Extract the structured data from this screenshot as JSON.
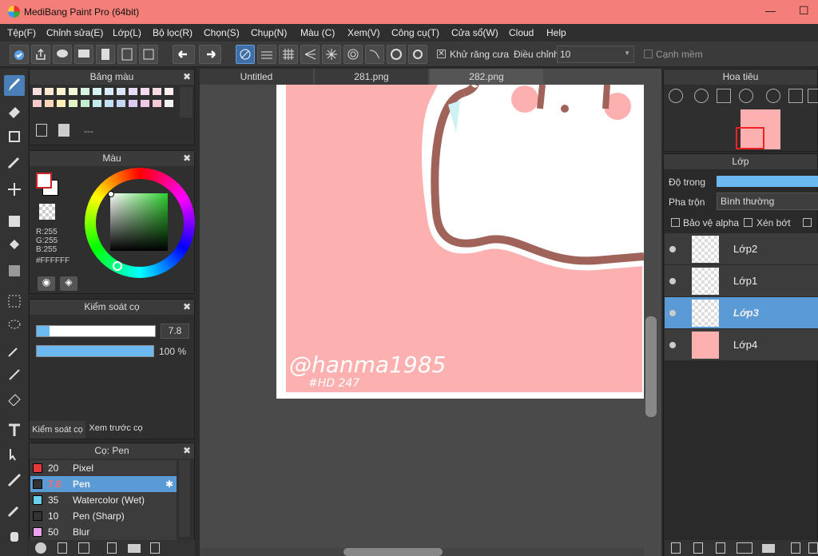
{
  "window": {
    "title": "MediBang Paint Pro (64bit)",
    "min": "—",
    "max": "☐"
  },
  "menu": [
    "Tệp(F)",
    "Chỉnh sửa(E)",
    "Lớp(L)",
    "Bộ lọc(R)",
    "Chọn(S)",
    "Chụp(N)",
    "Màu (C)",
    "Xem(V)",
    "Công cụ(T)",
    "Cửa sổ(W)",
    "Cloud",
    "Help"
  ],
  "toolbar": {
    "antialias_label": "Khử răng cưa",
    "correction_label": "Điều chỉnh",
    "correction_value": "10",
    "soft_edge_label": "Cạnh mềm"
  },
  "palette_panel": {
    "title": "Bảng màu",
    "close": "✖",
    "value": "---",
    "swatches": [
      "#f8e0e0",
      "#fde8d0",
      "#fff6d0",
      "#f0f8d8",
      "#d8f4e0",
      "#d8f4f2",
      "#d8ecf8",
      "#dce4f8",
      "#e8dcf8",
      "#f4dcf0",
      "#f8dce4",
      "#fff0f0",
      "#f7caca",
      "#fbd7b8",
      "#fff0b8",
      "#e4f3c4",
      "#c4ecd0",
      "#c4ecea",
      "#c4e0f4",
      "#c8d4f4",
      "#dccaf4",
      "#eecae8",
      "#f4c8d4",
      "#f2f2f2"
    ]
  },
  "color_panel": {
    "title": "Màu",
    "r": "R:255",
    "g": "G:255",
    "b": "B:255",
    "hex": "#FFFFFF"
  },
  "brush_control": {
    "title": "Kiểm soát cọ",
    "size_value": "7.8",
    "opacity_value": "100 %",
    "size_fill": 0.11,
    "opacity_fill": 1.0,
    "tab1": "Kiểm soát cọ",
    "tab2": "Xem trước cọ"
  },
  "brush_list": {
    "title": "Cọ: Pen",
    "items": [
      {
        "size": "20",
        "name": "Pixel",
        "color": "#e63a3a"
      },
      {
        "size": "7.8",
        "name": "Pen",
        "color": "#333333",
        "selected": true
      },
      {
        "size": "35",
        "name": "Watercolor (Wet)",
        "color": "#6ad0f0"
      },
      {
        "size": "10",
        "name": "Pen (Sharp)",
        "color": "#333333"
      },
      {
        "size": "50",
        "name": "Blur",
        "color": "#f0a0f0"
      }
    ]
  },
  "tabs": [
    "Untitled",
    "281.png",
    "282.png"
  ],
  "canvas": {
    "signature": "@hanma1985",
    "hashtag": "#HD 247"
  },
  "navigator": {
    "title": "Hoa tiêu"
  },
  "layer_panel": {
    "title": "Lớp",
    "opacity_label": "Độ trong",
    "blend_label": "Pha trộn",
    "blend_value": "Bình thường",
    "protect_alpha": "Bảo vệ alpha",
    "clipping": "Xén bớt",
    "layers": [
      {
        "name": "Lớp2"
      },
      {
        "name": "Lớp1"
      },
      {
        "name": "Lớp3",
        "selected": true
      },
      {
        "name": "Lớp4"
      }
    ]
  }
}
